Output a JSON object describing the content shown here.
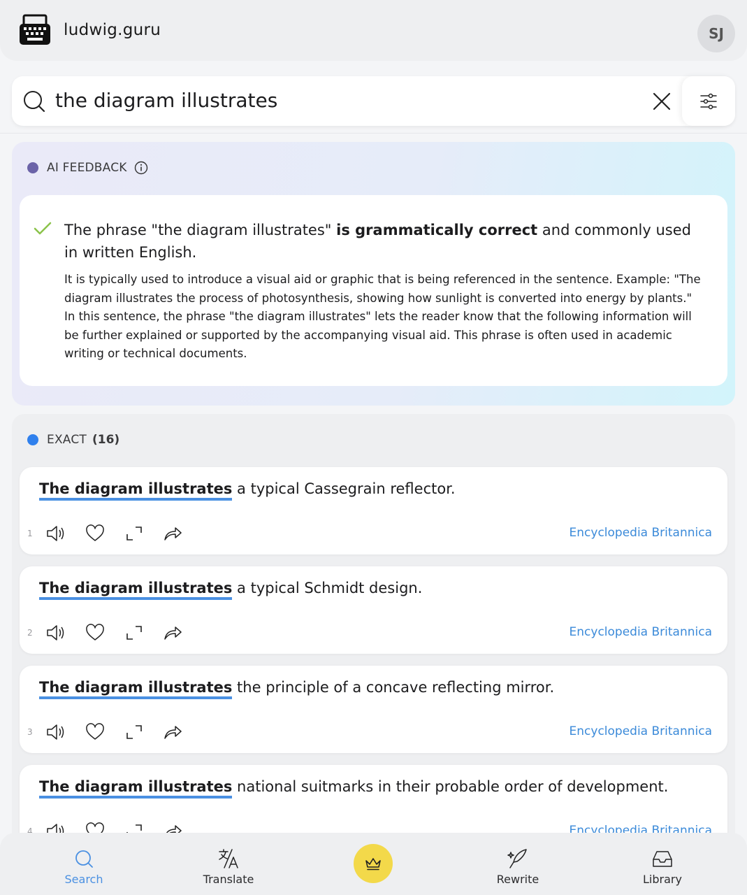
{
  "header": {
    "brand": "ludwig.guru",
    "avatar_initials": "SJ"
  },
  "search": {
    "query": "the diagram illustrates"
  },
  "ai_feedback": {
    "label": "AI FEEDBACK",
    "headline_pre": "The phrase \"the diagram illustrates\" ",
    "headline_bold": "is grammatically correct",
    "headline_post": " and commonly used in written English.",
    "body": "It is typically used to introduce a visual aid or graphic that is being referenced in the sentence. Example: \"The diagram illustrates the process of photosynthesis, showing how sunlight is converted into energy by plants.\" In this sentence, the phrase \"the diagram illustrates\" lets the reader know that the following information will be further explained or supported by the accompanying visual aid. This phrase is often used in academic writing or technical documents."
  },
  "exact": {
    "label": "EXACT",
    "count": "(16)",
    "results": [
      {
        "num": "1",
        "highlight": "The diagram illustrates",
        "rest": " a typical Cassegrain reflector.",
        "source": "Encyclopedia Britannica"
      },
      {
        "num": "2",
        "highlight": "The diagram illustrates",
        "rest": " a typical Schmidt design.",
        "source": "Encyclopedia Britannica"
      },
      {
        "num": "3",
        "highlight": "The diagram illustrates",
        "rest": " the principle of a concave reflecting mirror.",
        "source": "Encyclopedia Britannica"
      },
      {
        "num": "4",
        "highlight": "The diagram illustrates",
        "rest": " national suitmarks in their probable order of development.",
        "source": "Encyclopedia Britannica"
      }
    ]
  },
  "nav": {
    "search": "Search",
    "translate": "Translate",
    "rewrite": "Rewrite",
    "library": "Library"
  },
  "colors": {
    "accent": "#4a90e2",
    "ai_dot": "#6b63a8",
    "exact_dot": "#2f80ed",
    "premium": "#f3d94a",
    "check": "#8bc34a"
  }
}
